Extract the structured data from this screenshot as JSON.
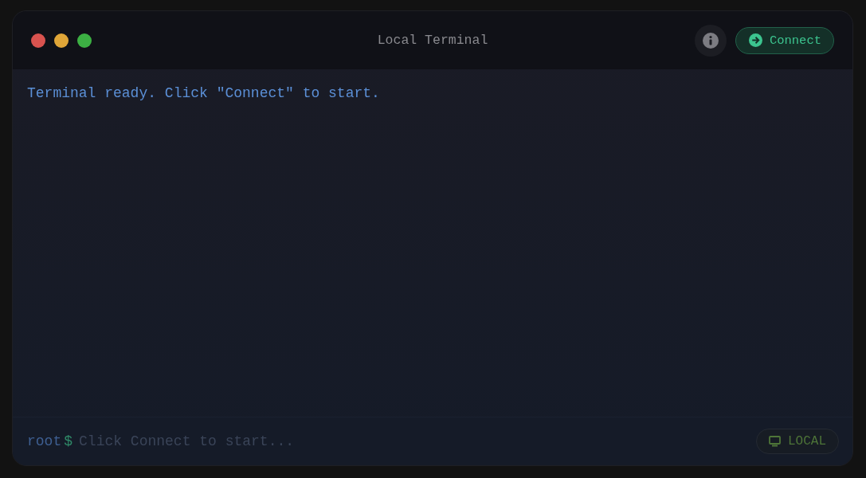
{
  "window": {
    "title": "Local Terminal",
    "controls": [
      {
        "color": "#d9534f"
      },
      {
        "color": "#e0a638"
      },
      {
        "color": "#3cb043"
      }
    ]
  },
  "toolbar": {
    "connect_button": "Connect"
  },
  "output": [
    "Terminal ready. Click \"Connect\" to start."
  ],
  "prompt": {
    "user": "root",
    "symbol": "$",
    "placeholder": "Click Connect to start..."
  },
  "mode_badge": "LOCAL"
}
